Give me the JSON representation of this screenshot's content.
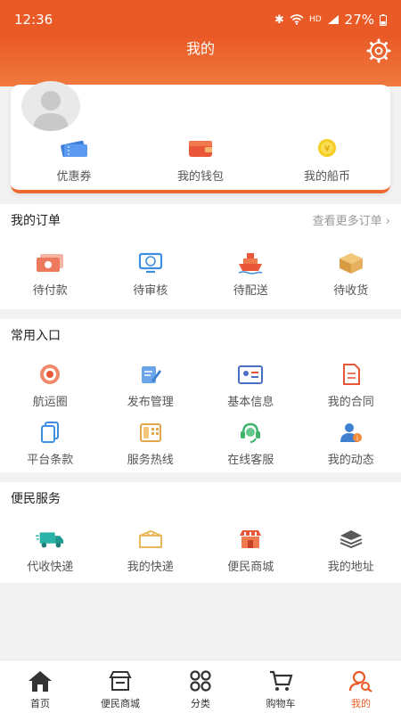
{
  "status_bar": {
    "time": "12:36",
    "network": "HD",
    "battery": "27%"
  },
  "header": {
    "title": "我的"
  },
  "wallet": [
    {
      "label": "优惠券",
      "icon": "coupon-icon"
    },
    {
      "label": "我的钱包",
      "icon": "wallet-icon"
    },
    {
      "label": "我的船币",
      "icon": "coin-icon"
    }
  ],
  "orders": {
    "title": "我的订单",
    "more": "查看更多订单",
    "items": [
      {
        "label": "待付款",
        "icon": "pending-payment-icon"
      },
      {
        "label": "待审核",
        "icon": "pending-review-icon"
      },
      {
        "label": "待配送",
        "icon": "pending-delivery-icon"
      },
      {
        "label": "待收货",
        "icon": "pending-receipt-icon"
      }
    ]
  },
  "common": {
    "title": "常用入口",
    "items": [
      {
        "label": "航运圈",
        "icon": "shipping-circle-icon"
      },
      {
        "label": "发布管理",
        "icon": "publish-icon"
      },
      {
        "label": "基本信息",
        "icon": "id-card-icon"
      },
      {
        "label": "我的合同",
        "icon": "contract-icon"
      },
      {
        "label": "平台条款",
        "icon": "terms-icon"
      },
      {
        "label": "服务热线",
        "icon": "hotline-icon"
      },
      {
        "label": "在线客服",
        "icon": "customer-service-icon"
      },
      {
        "label": "我的动态",
        "icon": "user-info-icon"
      }
    ]
  },
  "service": {
    "title": "便民服务",
    "items": [
      {
        "label": "代收快递",
        "icon": "delivery-truck-icon"
      },
      {
        "label": "我的快递",
        "icon": "parcel-icon"
      },
      {
        "label": "便民商城",
        "icon": "shop-icon"
      },
      {
        "label": "我的地址",
        "icon": "address-layers-icon"
      }
    ]
  },
  "tabbar": [
    {
      "label": "首页",
      "icon": "home-icon"
    },
    {
      "label": "便民商城",
      "icon": "store-icon"
    },
    {
      "label": "分类",
      "icon": "grid-icon"
    },
    {
      "label": "购物车",
      "icon": "cart-icon"
    },
    {
      "label": "我的",
      "icon": "user-search-icon",
      "active": true
    }
  ],
  "colors": {
    "accent": "#ea5a27",
    "background": "#f2f2f2"
  }
}
